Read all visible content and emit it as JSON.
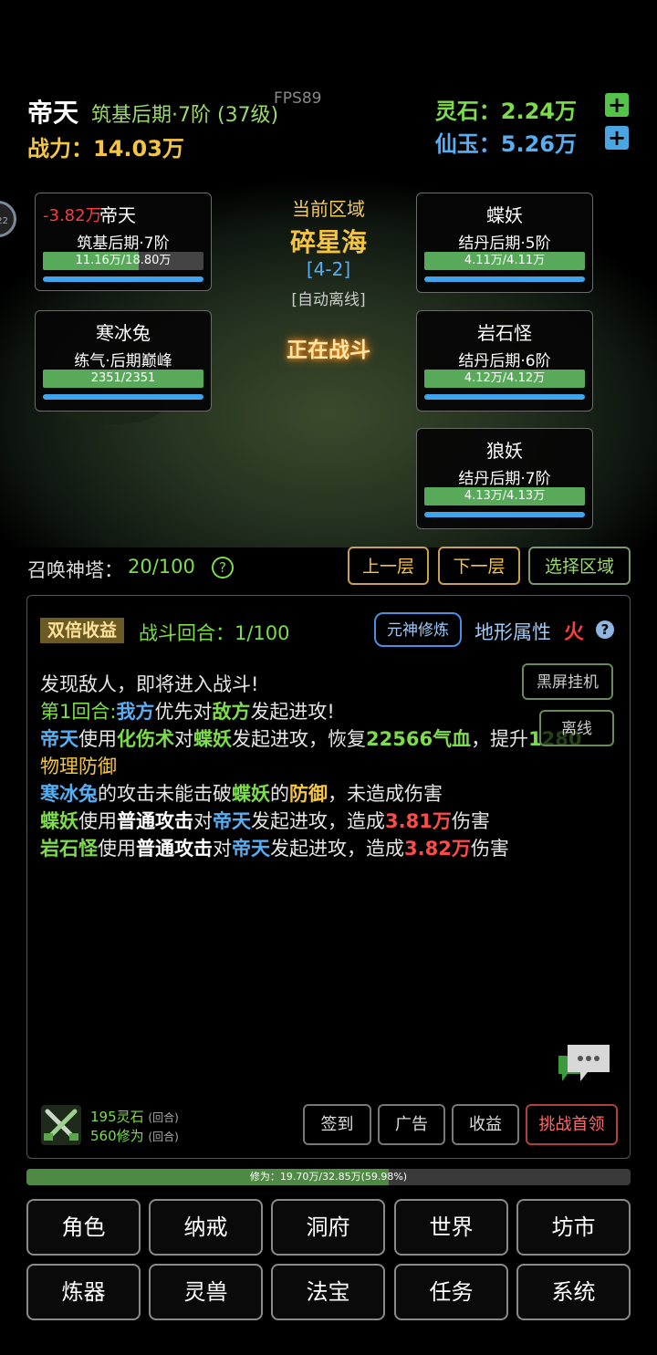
{
  "header": {
    "player_name": "帝天",
    "player_realm": "筑基后期·7阶 (37级)",
    "fps": "FPS89",
    "power": "战力：14.03万",
    "lingshi": "灵石：2.24万",
    "xianyu": "仙玉：5.26万",
    "plus": "+"
  },
  "avatar_badge": "22",
  "area": {
    "label": "当前区域",
    "name": "碎星海",
    "stage": "[4-2]",
    "mode": "[自动离线]",
    "status": "正在战斗"
  },
  "allies": [
    {
      "name": "帝天",
      "damage": "-3.82万",
      "realm": "筑基后期·7阶",
      "hp_text": "11.16万/18.80万",
      "hp_ratio": 0.594
    },
    {
      "name": "寒冰兔",
      "realm": "练气·后期巅峰",
      "hp_text": "2351/2351",
      "hp_ratio": 1.0
    }
  ],
  "enemies": [
    {
      "name": "蝶妖",
      "realm": "结丹后期·5阶",
      "hp_text": "4.11万/4.11万",
      "hp_ratio": 1.0
    },
    {
      "name": "岩石怪",
      "realm": "结丹后期·6阶",
      "hp_text": "4.12万/4.12万",
      "hp_ratio": 1.0
    },
    {
      "name": "狼妖",
      "realm": "结丹后期·7阶",
      "hp_text": "4.13万/4.13万",
      "hp_ratio": 1.0
    }
  ],
  "tower": {
    "label": "召唤神塔：",
    "count": "20/100",
    "help": "?",
    "up": "上一层",
    "down": "下一层",
    "select_area": "选择区域"
  },
  "log_panel": {
    "double_badge": "双倍收益",
    "round": "战斗回合：1/100",
    "yuanshen": "元神修炼",
    "terrain_label": "地形属性",
    "terrain_value": "火",
    "terrain_help": "?",
    "blackscreen": "黑屏挂机",
    "offline": "离线"
  },
  "log": {
    "l1": "发现敌人，即将进入战斗!",
    "l2": {
      "a": "第1回合:",
      "b": "我方",
      "c": "优先对",
      "d": "敌方",
      "e": "发起进攻!"
    },
    "l3": {
      "a": "帝天",
      "b": "使用",
      "c": "化伤术",
      "d": "对",
      "e": "蝶妖",
      "f": "发起进攻，恢复",
      "g": "22566",
      "h": "气血",
      "i": "，提升",
      "j": "1280"
    },
    "l4": "物理防御",
    "l5": {
      "a": "寒冰兔",
      "b": "的攻击未能击破",
      "c": "蝶妖",
      "d": "的",
      "e": "防御",
      "f": "，未造成伤害"
    },
    "l6": {
      "a": "蝶妖",
      "b": "使用",
      "c": "普通攻击",
      "d": "对",
      "e": "帝天",
      "f": "发起进攻，造成",
      "g": "3.81万",
      "h": "伤害"
    },
    "l7": {
      "a": "岩石怪",
      "b": "使用",
      "c": "普通攻击",
      "d": "对",
      "e": "帝天",
      "f": "发起进攻，造成",
      "g": "3.82万",
      "h": "伤害"
    }
  },
  "rewards": {
    "lingshi": "195灵石",
    "xiuwei": "560修为",
    "suffix": "(回合)"
  },
  "actions": {
    "sign": "签到",
    "ad": "广告",
    "income": "收益",
    "challenge": "挑战首领"
  },
  "cultivation": {
    "text": "修为：19.70万/32.85万(59.98%)",
    "ratio": 0.5998
  },
  "nav": {
    "role": "角色",
    "ring": "纳戒",
    "cave": "洞府",
    "world": "世界",
    "market": "坊市",
    "forge": "炼器",
    "beast": "灵兽",
    "treasure": "法宝",
    "task": "任务",
    "system": "系统"
  },
  "colors": {
    "gold": "#f5c542",
    "green": "#7ddc4b",
    "blue": "#58aef2",
    "red": "#ff4a4a",
    "hp_green": "#58a95a",
    "mp_blue": "#3fa4ec"
  }
}
